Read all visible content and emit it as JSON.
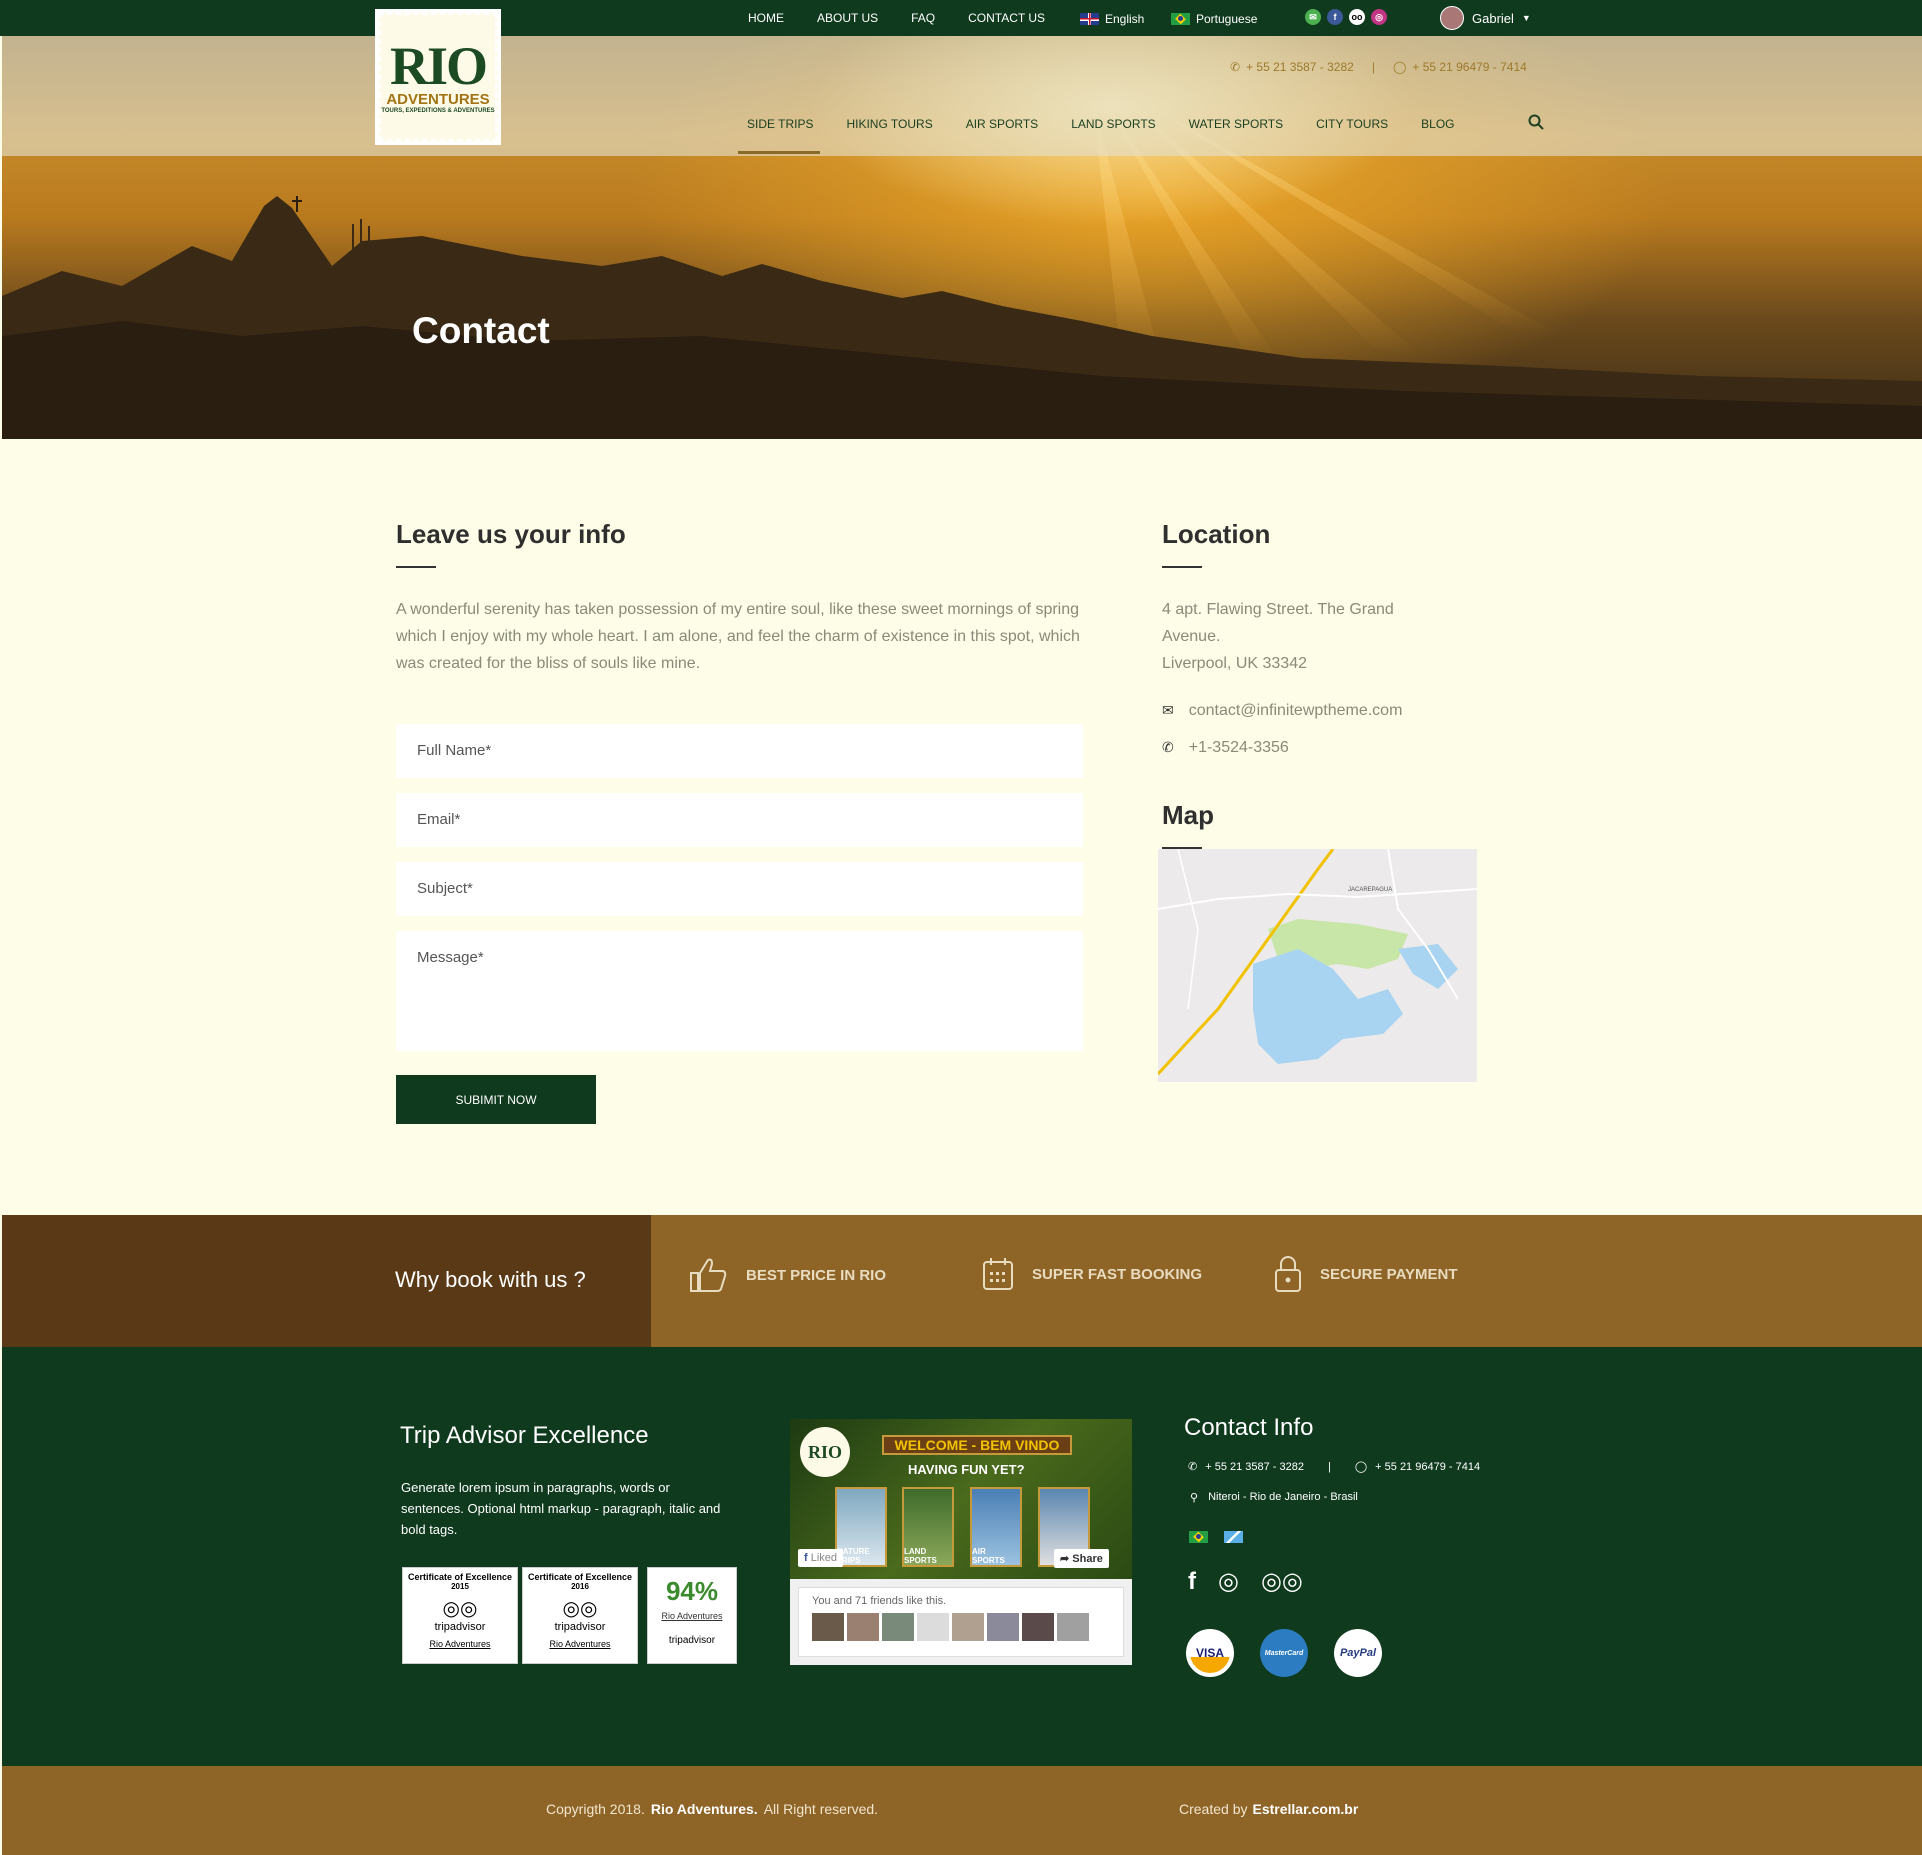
{
  "topbar": {
    "nav": [
      "HOME",
      "ABOUT US",
      "FAQ",
      "CONTACT US"
    ],
    "languages": [
      {
        "label": "English",
        "flag": "uk-flag-icon"
      },
      {
        "label": "Portuguese",
        "flag": "brazil-flag-icon"
      }
    ],
    "user": "Gabriel"
  },
  "header": {
    "logo": {
      "title": "RIO",
      "subtitle": "ADVENTURES",
      "tagline": "TOURS, EXPEDITIONS & ADVENTURES"
    },
    "phone": "+ 55 21 3587 - 3282",
    "separator": "|",
    "whatsapp": "+ 55 21 96479 - 7414",
    "nav": [
      "SIDE TRIPS",
      "HIKING TOURS",
      "AIR SPORTS",
      "LAND SPORTS",
      "WATER SPORTS",
      "CITY TOURS",
      "BLOG"
    ]
  },
  "hero": {
    "title": "Contact"
  },
  "form": {
    "heading": "Leave us your info",
    "intro": "A wonderful serenity has taken possession of my entire soul, like these sweet mornings of spring which I enjoy with my whole heart. I am alone, and feel the charm of existence in this spot, which was created for the bliss of souls like mine.",
    "full_name": "Full Name*",
    "email": "Email*",
    "subject": "Subject*",
    "message": "Message*",
    "submit": "SUBIMIT NOW"
  },
  "location": {
    "heading": "Location",
    "address_line1": "4 apt. Flawing Street. The Grand",
    "address_line2": "Avenue.",
    "address_line3": "Liverpool, UK 33342",
    "email": "contact@infinitewptheme.com",
    "phone": "+1-3524-3356",
    "map_heading": "Map",
    "map_label": "JACAREPAGUA"
  },
  "why": {
    "title": "Why book with us ?",
    "items": [
      "BEST PRICE IN RIO",
      "SUPER FAST BOOKING",
      "SECURE PAYMENT"
    ]
  },
  "footer": {
    "trip_title": "Trip Advisor Excellence",
    "trip_text": "Generate lorem ipsum in paragraphs, words or sentences. Optional html markup - paragraph, italic and bold tags.",
    "badges": [
      {
        "title": "Certificate of Excellence",
        "year": "2015",
        "brand": "tripadvisor",
        "name": "Rio Adventures"
      },
      {
        "title": "Certificate of Excellence",
        "year": "2016",
        "brand": "tripadvisor",
        "name": "Rio Adventures"
      }
    ],
    "rating": {
      "value": "94%",
      "name": "Rio Adventures",
      "brand": "tripadvisor"
    },
    "fb": {
      "welcome": "WELCOME - BEM VINDO",
      "fun": "HAVING FUN YET?",
      "tiles": [
        "NATURE TRIPS",
        "LAND SPORTS",
        "AIR SPORTS",
        ""
      ],
      "liked": "Liked",
      "share": "Share",
      "friends": "You and 71 friends like this."
    },
    "contact_title": "Contact Info",
    "phone": "+ 55 21 3587 - 3282",
    "separator": "|",
    "whatsapp": "+ 55 21 96479 - 7414",
    "address": "Niteroi - Rio de Janeiro - Brasil",
    "payments": [
      "VISA",
      "MasterCard",
      "PayPal"
    ]
  },
  "bottom": {
    "copyright_prefix": "Copyrigth 2018.",
    "brand": "Rio Adventures.",
    "rights": "All Right reserved.",
    "created_by": "Created by",
    "creator": "Estrellar.com.br"
  },
  "colors": {
    "dark_green": "#0f3a1e",
    "brown": "#8f6427",
    "dark_brown": "#5a3a16",
    "cream": "#fdfde8"
  }
}
